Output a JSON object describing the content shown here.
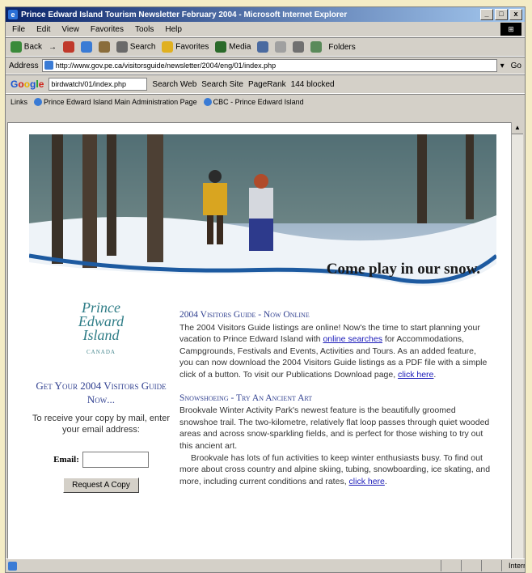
{
  "window": {
    "title": "Prince Edward Island Tourism Newsletter February 2004 - Microsoft Internet Explorer",
    "controls": {
      "minimize": "_",
      "maximize": "□",
      "close": "x"
    }
  },
  "menu": [
    "File",
    "Edit",
    "View",
    "Favorites",
    "Tools",
    "Help"
  ],
  "toolbar": {
    "back": "Back",
    "forward": "→",
    "search": "Search",
    "favorites": "Favorites",
    "media": "Media",
    "folders": "Folders"
  },
  "address": {
    "label": "Address",
    "url": "http://www.gov.pe.ca/visitorsguide/newsletter/2004/eng/01/index.php",
    "go": "Go"
  },
  "google_bar": {
    "logo": [
      "G",
      "o",
      "o",
      "g",
      "l",
      "e"
    ],
    "query": "birdwatch/01/index.php",
    "search_web": "Search Web",
    "search_site": "Search Site",
    "pagerank": "PageRank",
    "blocked": "144 blocked"
  },
  "links": {
    "label": "Links",
    "items": [
      "Prince Edward Island Main Administration Page",
      "CBC - Prince Edward Island"
    ]
  },
  "banner": {
    "tagline": "Come play in our snow."
  },
  "sidebar": {
    "logo_line1": "Prince",
    "logo_line2": "Edward",
    "logo_line3": "Island",
    "logo_sub": "CANADA",
    "get_guide": "Get Your 2004 Visitors Guide Now...",
    "receive_text": "To receive your copy by mail, enter your email address:",
    "email_label": "Email:",
    "email_value": "",
    "request_button": "Request A Copy"
  },
  "articles": [
    {
      "title": "2004 Visitors Guide - Now Online",
      "body_before_link": "The 2004 Visitors Guide listings are online! Now's the time to start planning your vacation to Prince Edward Island with ",
      "link1": "online searches",
      "body_middle": " for Accommodations, Campgrounds, Festivals and Events, Activities and Tours. As an added feature, you can now download the 2004 Visitors Guide listings as a PDF file with a simple click of a button. To visit our Publications Download page, ",
      "link2": "click here",
      "body_end": "."
    },
    {
      "title": "Snowshoeing - Try An Ancient Art",
      "para1": "Brookvale Winter Activity Park's newest feature is the beautifully groomed snowshoe trail. The two-kilometre, relatively flat loop passes through quiet wooded areas and across snow-sparkling fields, and is perfect for those wishing to try out this ancient art.",
      "para2_before_link": "Brookvale has lots of fun activities to keep winter enthusiasts busy. To find out more about cross country and alpine skiing, tubing, snowboarding, ice skating, and more, including current conditions and rates, ",
      "link": "click here",
      "para2_end": "."
    }
  ],
  "status": {
    "zone": "Internet"
  },
  "colors": {
    "title_blue": "#0a246a",
    "heading_blue": "#2f3f8f",
    "logo_teal": "#2f7d87",
    "link": "#1a1ab8"
  }
}
